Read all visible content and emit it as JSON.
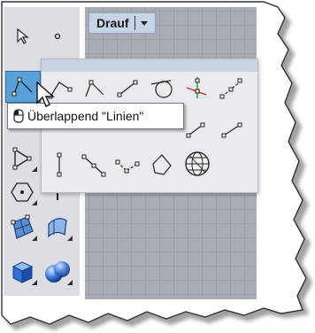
{
  "viewport": {
    "title": "Drauf"
  },
  "tooltip": {
    "text": "Überlappend \"Linien\"",
    "icon": "left-mouse-button-icon"
  },
  "left_toolbar": {
    "tools": [
      "select-icon",
      "point-icon",
      "polyline-icon",
      "circle-icon",
      "arc-icon",
      "polygon-icon",
      "surface-icon",
      "revolve-icon",
      "box-icon",
      "sphere-icon"
    ]
  },
  "flyout": {
    "tools": [
      "polyline-icon",
      "line-segments-icon",
      "line-from-midpoint-icon",
      "tangent-line-icon",
      "perpendicular-line-icon",
      "bisector-line-icon",
      "line-from-normal-icon",
      "convert-line-icon",
      "polygon-outline-icon",
      "sphere-grid-icon"
    ]
  },
  "colors": {
    "toolbar_bg": "#dcdee3",
    "viewport_bg": "#a9adb3",
    "tab_bg": "#c7d4e6",
    "flyout_header": "#c9d3e2",
    "active_tool": "#5aa0d8"
  }
}
